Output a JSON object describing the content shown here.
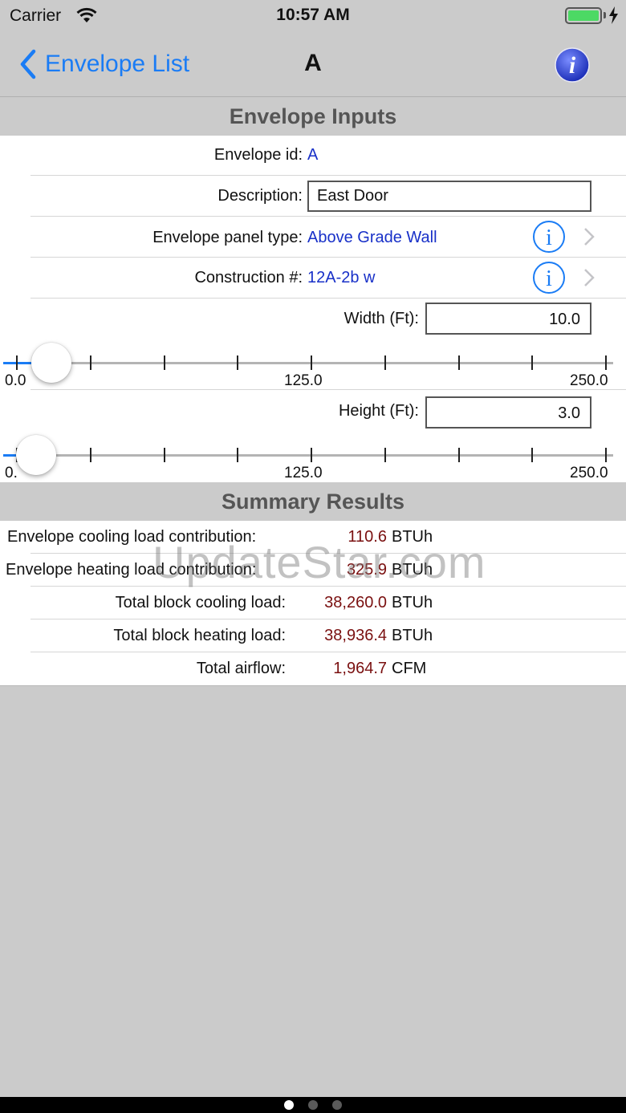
{
  "status_bar": {
    "carrier": "Carrier",
    "time": "10:57 AM"
  },
  "nav": {
    "back_label": "Envelope List",
    "title": "A"
  },
  "inputs": {
    "header": "Envelope Inputs",
    "envelope_id_label": "Envelope id:",
    "envelope_id_value": "A",
    "description_label": "Description:",
    "description_value": "East Door",
    "panel_type_label": "Envelope panel type:",
    "panel_type_value": "Above Grade Wall",
    "construction_label": "Construction #:",
    "construction_value": "12A-2b w",
    "width_label": "Width (Ft):",
    "width_value": "10.0",
    "width_slider": {
      "min_label": "0.0",
      "mid_label": "125.0",
      "max_label": "250.0",
      "min": 0,
      "max": 250,
      "value": 10
    },
    "height_label": "Height (Ft):",
    "height_value": "3.0",
    "height_slider": {
      "min_label": "0.",
      "mid_label": "125.0",
      "max_label": "250.0",
      "min": 0,
      "max": 250,
      "value": 3
    }
  },
  "summary": {
    "header": "Summary Results",
    "rows": [
      {
        "label": "Envelope cooling load contribution:",
        "value": "110.6",
        "unit": "BTUh"
      },
      {
        "label": "Envelope heating load contribution:",
        "value": "325.9",
        "unit": "BTUh"
      },
      {
        "label": "Total block cooling load:",
        "value": "38,260.0",
        "unit": "BTUh"
      },
      {
        "label": "Total block heating load:",
        "value": "38,936.4",
        "unit": "BTUh"
      },
      {
        "label": "Total airflow:",
        "value": "1,964.7",
        "unit": "CFM"
      }
    ]
  },
  "watermark": "UpdateStar.com",
  "page_control": {
    "pages": 3,
    "current": 1
  },
  "colors": {
    "accent": "#1a7cf5",
    "value_blue": "#1830c8",
    "result_red": "#7a1010",
    "background": "#cbcbcb"
  }
}
